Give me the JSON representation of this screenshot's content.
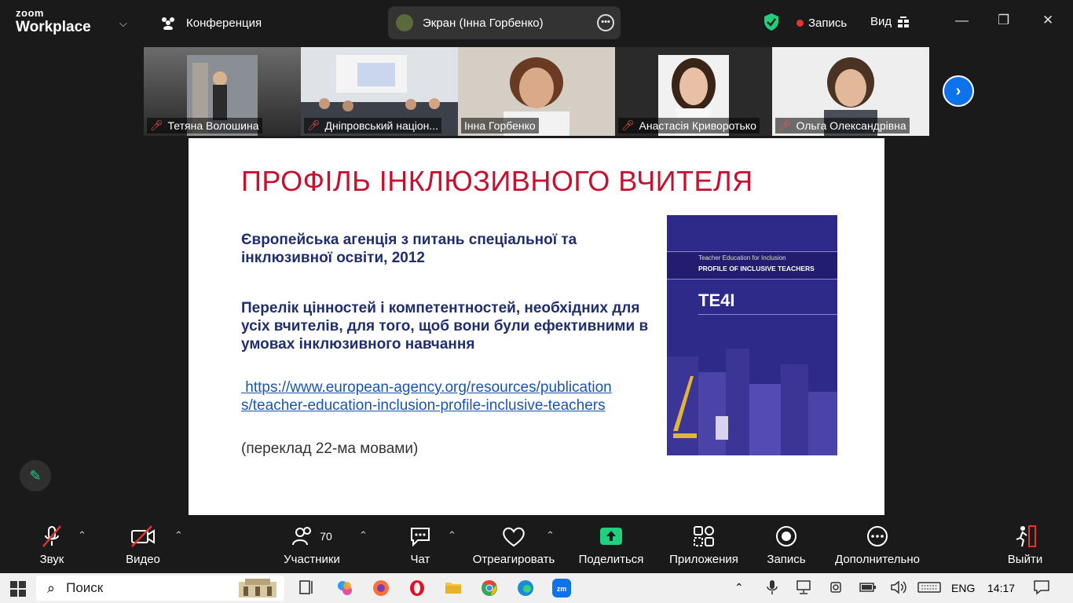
{
  "app": {
    "logo_line1": "zoom",
    "logo_line2": "Workplace"
  },
  "header": {
    "conference_label": "Конференция",
    "screen_share_label": "Экран (Інна Горбенко)",
    "record_label": "Запись",
    "view_label": "Вид"
  },
  "participants": [
    {
      "name": "Тетяна Волошина",
      "muted": true
    },
    {
      "name": "Дніпровський націон...",
      "muted": true
    },
    {
      "name": "Інна Горбенко",
      "muted": false,
      "active": true
    },
    {
      "name": "Анастасія Криворотько",
      "muted": true
    },
    {
      "name": "Ольга Олександрівна",
      "muted": true
    }
  ],
  "slide": {
    "title": "ПРОФІЛЬ ІНКЛЮЗИВНОГО ВЧИТЕЛЯ",
    "paragraph1": "Європейська агенція з питань спеціальної та інклюзивної освіти, 2012",
    "paragraph2": "Перелік цінностей і компетентностей, необхідних для усіх вчителів, для  того, щоб вони були ефективними в умовах інклюзивного навчання",
    "link": "https://www.european-agency.org/resources/publications/teacher-education-inclusion-profile-inclusive-teachers",
    "note": "(переклад 22-ма мовами)",
    "cover_line1": "Teacher Education for Inclusion",
    "cover_line2": "PROFILE OF INCLUSIVE TEACHERS",
    "cover_logo": "TE4I"
  },
  "toolbar": {
    "audio": "Звук",
    "video": "Видео",
    "participants": "Участники",
    "participants_count": "70",
    "chat": "Чат",
    "react": "Отреагировать",
    "share": "Поделиться",
    "apps": "Приложения",
    "record": "Запись",
    "more": "Дополнительно",
    "leave": "Выйти"
  },
  "taskbar": {
    "search_placeholder": "Поиск",
    "language": "ENG",
    "time": "14:17"
  },
  "colors": {
    "accent_green": "#20d07e",
    "zoom_blue": "#0e72ed",
    "slide_title_red": "#c8102e",
    "slide_text_navy": "#1f2f6e"
  }
}
